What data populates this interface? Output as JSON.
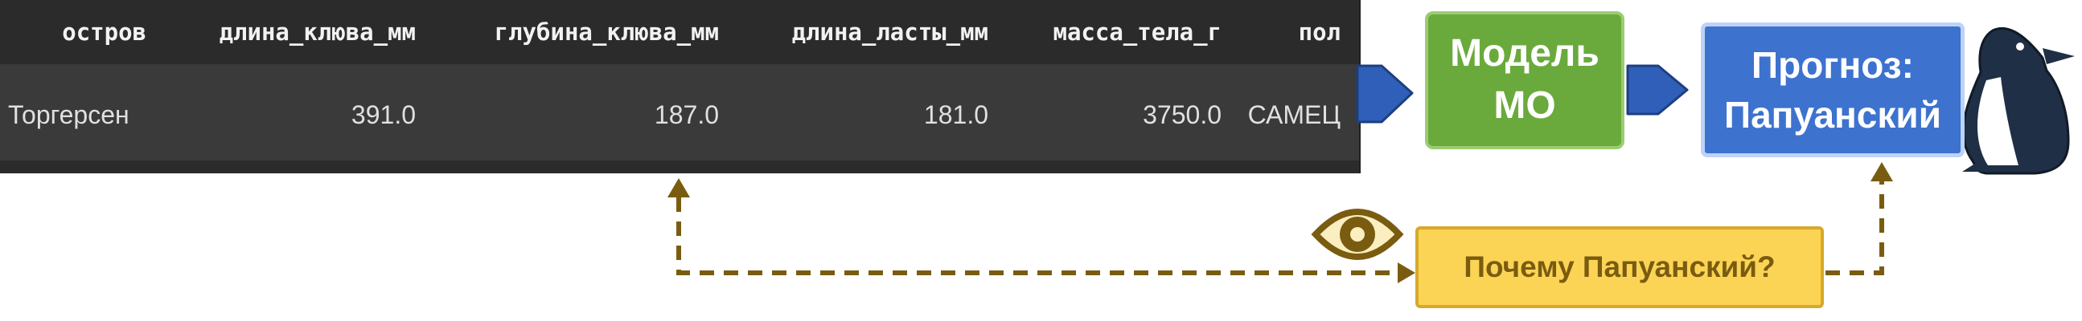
{
  "table": {
    "columns": [
      "остров",
      "длина_клюва_мм",
      "глубина_клюва_мм",
      "длина_ласты_мм",
      "масса_тела_г",
      "пол"
    ],
    "row": [
      "Торгерсен",
      "391.0",
      "187.0",
      "181.0",
      "3750.0",
      "САМЕЦ"
    ]
  },
  "model_box": {
    "line1": "Модель",
    "line2": "МО"
  },
  "prediction_box": {
    "line1": "Прогноз:",
    "line2": "Папуанский"
  },
  "question_box": {
    "text": "Почему Папуанский?"
  },
  "icons": {
    "eye": "eye-icon",
    "penguin": "penguin-icon"
  },
  "colors": {
    "table_bg": "#3a3a3a",
    "model": "#6aaa3c",
    "prediction": "#3d72cf",
    "question": "#fcd455",
    "arrow_blue": "#2f5fb8",
    "dashed": "#7a5c10"
  }
}
